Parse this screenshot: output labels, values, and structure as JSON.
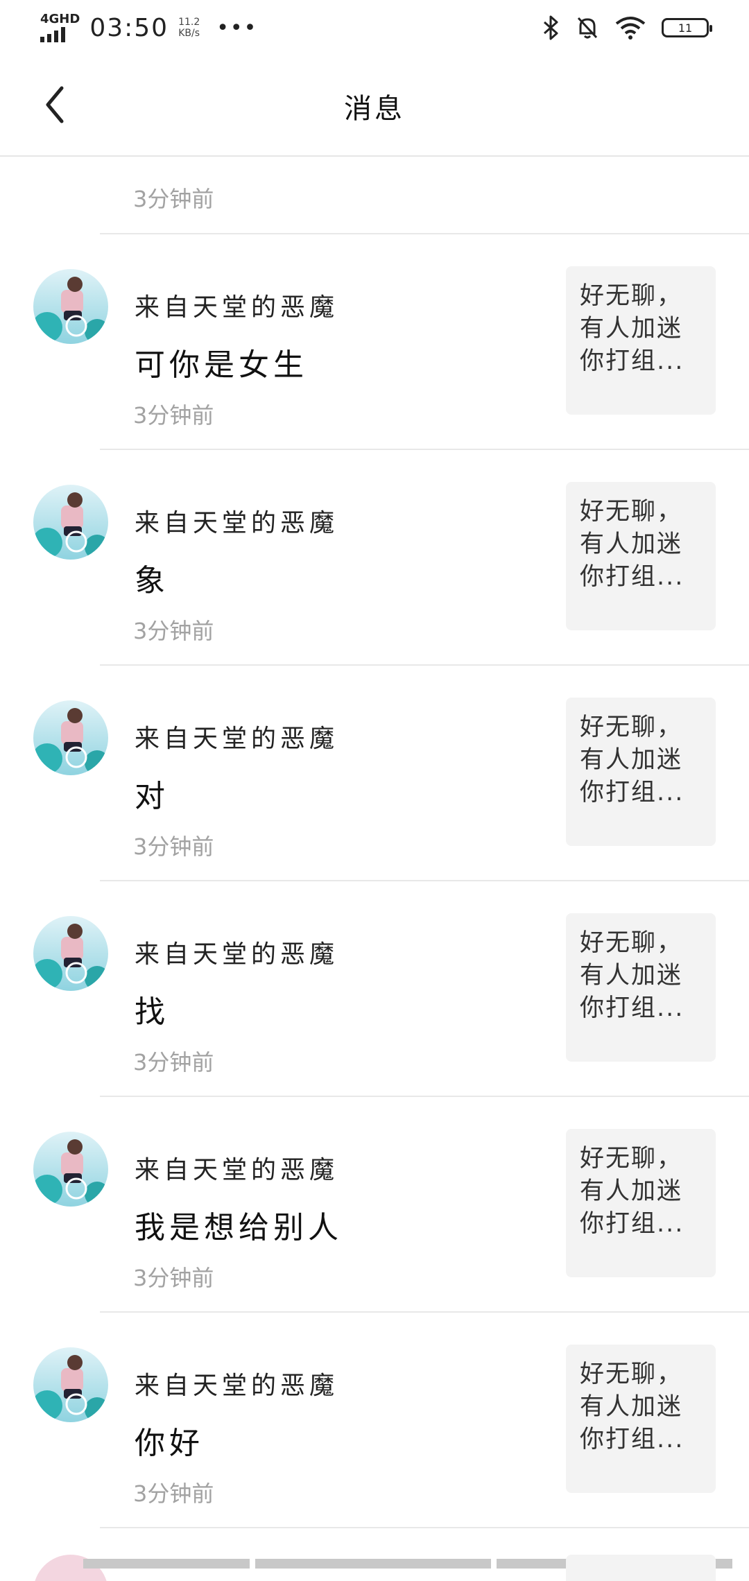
{
  "status_bar": {
    "network": "4GHD",
    "time": "03:50",
    "speed_value": "11.2",
    "speed_unit": "KB/s",
    "dots": "•••",
    "battery": "11"
  },
  "nav": {
    "title": "消息"
  },
  "list": {
    "partial_top_time": "3分钟前",
    "items": [
      {
        "name": "来自天堂的恶魔",
        "message": "可你是女生",
        "time": "3分钟前",
        "preview": "好无聊，有人加迷你打组..."
      },
      {
        "name": "来自天堂的恶魔",
        "message": "象",
        "time": "3分钟前",
        "preview": "好无聊，有人加迷你打组..."
      },
      {
        "name": "来自天堂的恶魔",
        "message": "对",
        "time": "3分钟前",
        "preview": "好无聊，有人加迷你打组..."
      },
      {
        "name": "来自天堂的恶魔",
        "message": "找",
        "time": "3分钟前",
        "preview": "好无聊，有人加迷你打组..."
      },
      {
        "name": "来自天堂的恶魔",
        "message": "我是想给别人",
        "time": "3分钟前",
        "preview": "好无聊，有人加迷你打组..."
      },
      {
        "name": "来自天堂的恶魔",
        "message": "你好",
        "time": "3分钟前",
        "preview": "好无聊，有人加迷你打组..."
      }
    ]
  },
  "icons": {
    "back": "chevron-left-icon",
    "bluetooth": "bluetooth-icon",
    "mute": "bell-off-icon",
    "wifi": "wifi-icon",
    "battery": "battery-icon"
  }
}
